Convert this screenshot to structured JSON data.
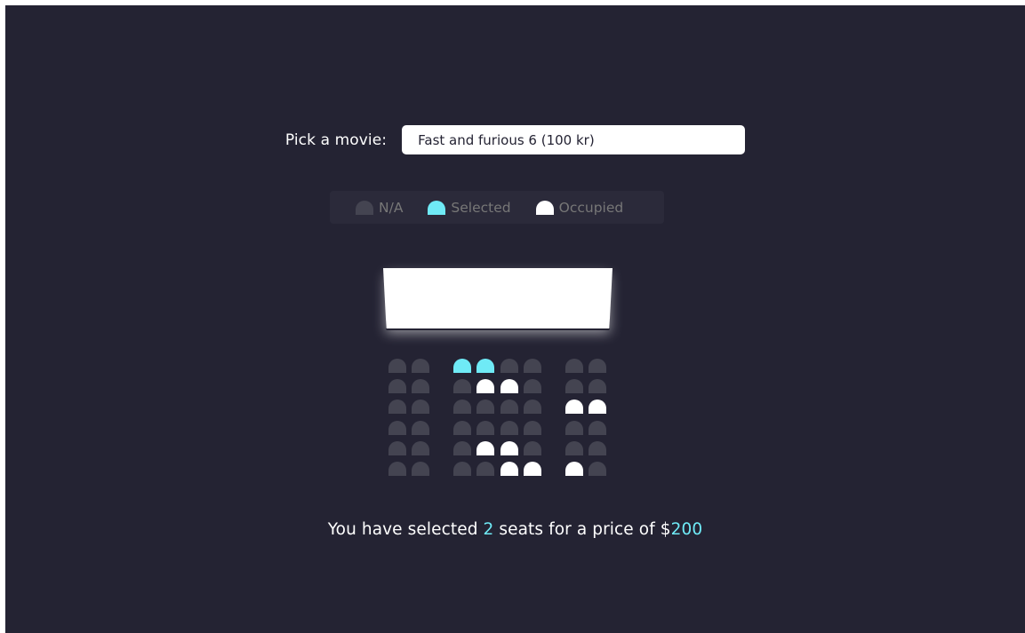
{
  "movie_picker": {
    "label": "Pick a movie:",
    "selected": "Fast and furious 6 (100 kr)"
  },
  "legend": {
    "na": "N/A",
    "selected": "Selected",
    "occupied": "Occupied"
  },
  "seat_map": {
    "rows": [
      [
        "na",
        "na",
        "selected",
        "selected",
        "na",
        "na",
        "na",
        "na"
      ],
      [
        "na",
        "na",
        "na",
        "occupied",
        "occupied",
        "na",
        "na",
        "na"
      ],
      [
        "na",
        "na",
        "na",
        "na",
        "na",
        "na",
        "occupied",
        "occupied"
      ],
      [
        "na",
        "na",
        "na",
        "na",
        "na",
        "na",
        "na",
        "na"
      ],
      [
        "na",
        "na",
        "na",
        "occupied",
        "occupied",
        "na",
        "na",
        "na"
      ],
      [
        "na",
        "na",
        "na",
        "na",
        "occupied",
        "occupied",
        "occupied",
        "na"
      ]
    ]
  },
  "summary": {
    "prefix": "You have selected ",
    "count": "2",
    "middle": " seats for a price of $",
    "total": "200"
  },
  "colors": {
    "background": "#242333",
    "seat_na": "#444451",
    "seat_selected": "#6feaf6",
    "seat_occupied": "#ffffff"
  }
}
